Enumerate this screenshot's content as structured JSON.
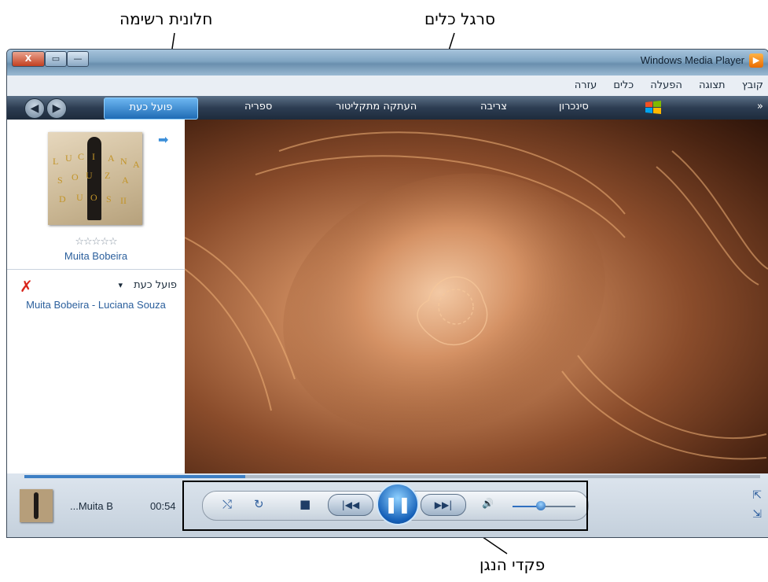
{
  "callouts": {
    "list_pane": "חלונית רשימה",
    "toolbar": "סרגל כלים",
    "player_controls": "פקדי הנגן"
  },
  "window": {
    "title": "Windows Media Player",
    "buttons": {
      "close": "X",
      "maximize": "▭",
      "minimize": "—"
    }
  },
  "menu": [
    "קובץ",
    "תצוגה",
    "הפעלה",
    "כלים",
    "עזרה"
  ],
  "nav": {
    "now_playing": "פועל כעת",
    "tabs": [
      "ספריה",
      "העתקה מתקליטור",
      "צריבה",
      "סינכרון"
    ],
    "more": "»"
  },
  "list_pane": {
    "album_letters": [
      "L",
      "U",
      "C",
      "I",
      "A",
      "N",
      "A",
      "S",
      "O",
      "U",
      "Z",
      "A",
      "D",
      "U",
      "O",
      "S",
      "II"
    ],
    "stars": "☆☆☆☆☆",
    "rating_stars": 5,
    "song_title": "Muita Bobeira",
    "playlist_header": "פועל כעת",
    "playlist_dropdown_icon": "▾",
    "remove_icon": "✗",
    "playlist_item": "Muita Bobeira - Luciana Souza"
  },
  "now_playing_bar": {
    "title": "...Muita B",
    "time": "00:54",
    "seek_progress": 0.3,
    "volume_level": 0.45
  },
  "controls": {
    "shuffle_icon": "⤭",
    "repeat_icon": "↻",
    "stop_icon": "■",
    "prev_icon": "|◀◀",
    "play_pause_icon": "❚❚",
    "next_icon": "▶▶|",
    "mute_icon": "🔊"
  },
  "corner_icons": {
    "fullscreen": "⇱",
    "compact": "⇲"
  },
  "colors": {
    "accent": "#1f6bb4",
    "link": "#2b5f9c",
    "toolbar": "#2d3d52",
    "remove": "#d9261c"
  }
}
